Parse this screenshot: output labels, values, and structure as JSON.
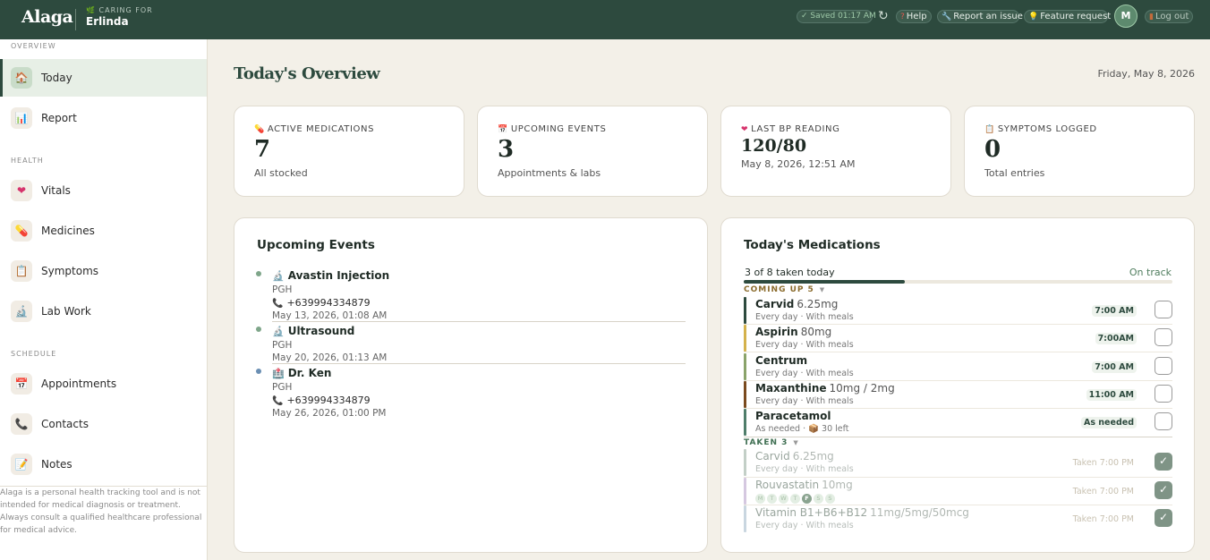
{
  "header": {
    "brand": "Alaga",
    "caring_label": "CARING FOR",
    "patient_name": "Erlinda",
    "saved": "✓ Saved 01:17 AM",
    "help": "Help",
    "report_issue": "Report an issue",
    "feature_request": "Feature request",
    "avatar_initial": "M",
    "logout": "Log out"
  },
  "sidebar": {
    "overview_label": "OVERVIEW",
    "health_label": "HEALTH",
    "schedule_label": "SCHEDULE",
    "items": [
      {
        "label": "Today",
        "icon": "house-icon",
        "glyph": "🏠",
        "active": true
      },
      {
        "label": "Report",
        "icon": "bar-chart-icon",
        "glyph": "📊"
      },
      {
        "label": "Vitals",
        "icon": "heart-icon",
        "glyph": "❤"
      },
      {
        "label": "Medicines",
        "icon": "pill-icon",
        "glyph": "💊"
      },
      {
        "label": "Symptoms",
        "icon": "clipboard-icon",
        "glyph": "📋"
      },
      {
        "label": "Lab Work",
        "icon": "microscope-icon",
        "glyph": "🔬"
      },
      {
        "label": "Appointments",
        "icon": "calendar-icon",
        "glyph": "📅"
      },
      {
        "label": "Contacts",
        "icon": "phone-icon",
        "glyph": "📞"
      },
      {
        "label": "Notes",
        "icon": "memo-icon",
        "glyph": "📝"
      }
    ],
    "disclaimer": "Alaga is a personal health tracking tool and is not intended for medical diagnosis or treatment. Always consult a qualified healthcare professional for medical advice."
  },
  "main": {
    "title": "Today's Overview",
    "date": "Friday, May 8, 2026",
    "stats": [
      {
        "label": "ACTIVE MEDICATIONS",
        "icon": "pill-icon",
        "value": "7",
        "sub": "All stocked"
      },
      {
        "label": "UPCOMING EVENTS",
        "icon": "calendar-icon",
        "value": "3",
        "sub": "Appointments & labs"
      },
      {
        "label": "LAST BP READING",
        "icon": "heart-icon",
        "value": "120/80",
        "sub": "May 8, 2026, 12:51 AM"
      },
      {
        "label": "SYMPTOMS LOGGED",
        "icon": "clipboard-icon",
        "value": "0",
        "sub": "Total entries"
      }
    ],
    "events_title": "Upcoming Events",
    "events": [
      {
        "title": "Avastin Injection",
        "icon": "microscope-icon",
        "place": "PGH",
        "phone": "+639994334879",
        "datetime": "May 13, 2026, 01:08 AM"
      },
      {
        "title": "Ultrasound",
        "icon": "microscope-icon",
        "place": "PGH",
        "datetime": "May 20, 2026, 01:13 AM"
      },
      {
        "title": "Dr. Ken",
        "icon": "hospital-icon",
        "place": "PGH",
        "phone": "+639994334879",
        "datetime": "May 26, 2026, 01:00 PM"
      }
    ],
    "meds_title": "Today's Medications",
    "progress_text": "3 of 8 taken today",
    "progress_value": 0.375,
    "progress_status": "On track",
    "coming_up_label": "COMING UP",
    "coming_up_count": "5",
    "taken_label": "TAKEN",
    "taken_count": "3",
    "coming_up": [
      {
        "name": "Carvid",
        "dose": "6.25mg",
        "sub": "Every day · With meals",
        "time": "7:00 AM",
        "color": "#2d4a3e"
      },
      {
        "name": "Aspirin",
        "dose": "80mg",
        "sub": "Every day · With meals",
        "time": "7:00AM",
        "color": "#d4b24c"
      },
      {
        "name": "Centrum",
        "dose": "",
        "sub": "Every day · With meals",
        "time": "7:00 AM",
        "color": "#8aa36a"
      },
      {
        "name": "Maxanthine",
        "dose": "10mg / 2mg",
        "sub": "Every day · With meals",
        "time": "11:00 AM",
        "color": "#7a4a1e"
      },
      {
        "name": "Paracetamol",
        "dose": "",
        "sub_prefix": "As needed ·",
        "sub_suffix": "30 left",
        "time": "As needed",
        "color": "#4f7d6a"
      }
    ],
    "taken": [
      {
        "name": "Carvid",
        "dose": "6.25mg",
        "sub": "Every day · With meals",
        "time": "Taken 7:00 PM",
        "color": "#c3cfc7"
      },
      {
        "name": "Rouvastatin",
        "dose": "10mg",
        "days": [
          "M",
          "T",
          "W",
          "T",
          "F",
          "S",
          "S"
        ],
        "active_day": "F",
        "time": "Taken 7:00 PM",
        "color": "#d5c8e0"
      },
      {
        "name": "Vitamin B1+B6+B12",
        "dose": "11mg/5mg/50mcg",
        "sub": "Every day · With meals",
        "time": "Taken 7:00 PM",
        "color": "#c9d6e0"
      }
    ]
  }
}
